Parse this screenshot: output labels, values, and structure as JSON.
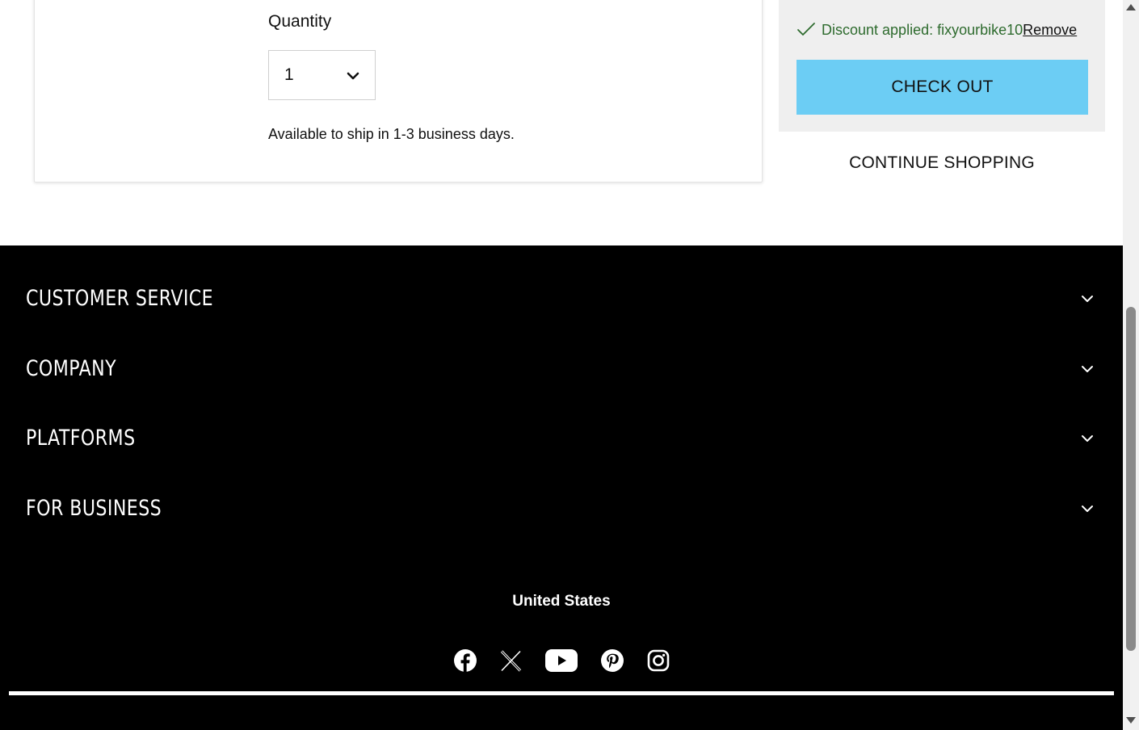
{
  "product": {
    "quantity_label": "Quantity",
    "quantity_value": "1",
    "shipping_note": "Available to ship in 1-3 business days."
  },
  "summary": {
    "discount_text": "Discount applied: fixyourbike10",
    "remove_label": "Remove",
    "checkout_label": "CHECK OUT",
    "continue_label": "CONTINUE SHOPPING"
  },
  "footer": {
    "sections": [
      {
        "title": "CUSTOMER SERVICE"
      },
      {
        "title": "COMPANY"
      },
      {
        "title": "PLATFORMS"
      },
      {
        "title": "FOR BUSINESS"
      }
    ],
    "country": "United States",
    "social_icons": [
      "facebook-icon",
      "x-icon",
      "youtube-icon",
      "pinterest-icon",
      "instagram-icon"
    ]
  },
  "colors": {
    "checkout_bg": "#6ccdf4",
    "discount_text": "#2e6b2e",
    "summary_bg": "#efefef",
    "footer_bg": "#000000"
  }
}
